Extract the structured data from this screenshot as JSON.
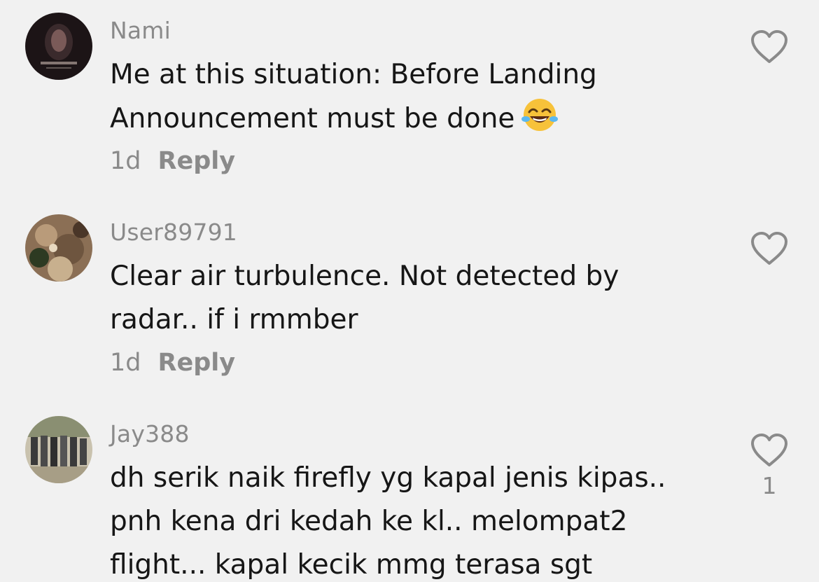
{
  "comments": [
    {
      "username": "Nami",
      "text_lines": [
        "Me at this situation: Before Landing",
        "Announcement must be done"
      ],
      "emoji": "laughing-tears-emoji",
      "time": "1d",
      "reply_label": "Reply",
      "like_count": ""
    },
    {
      "username": "User89791",
      "text_lines": [
        "Clear air turbulence. Not detected by",
        "radar.. if i rmmber"
      ],
      "time": "1d",
      "reply_label": "Reply",
      "like_count": ""
    },
    {
      "username": "Jay388",
      "text_lines": [
        "dh serik naik firefly yg kapal jenis kipas..",
        "pnh kena dri kedah ke kl.. melompat2",
        "flight... kapal kecik mmg terasa sgt"
      ],
      "like_count": "1"
    }
  ],
  "icons": {
    "like": "heart-outline-icon"
  },
  "colors": {
    "background": "#f1f1f1",
    "text": "#161616",
    "secondary": "#8a8a8a"
  }
}
